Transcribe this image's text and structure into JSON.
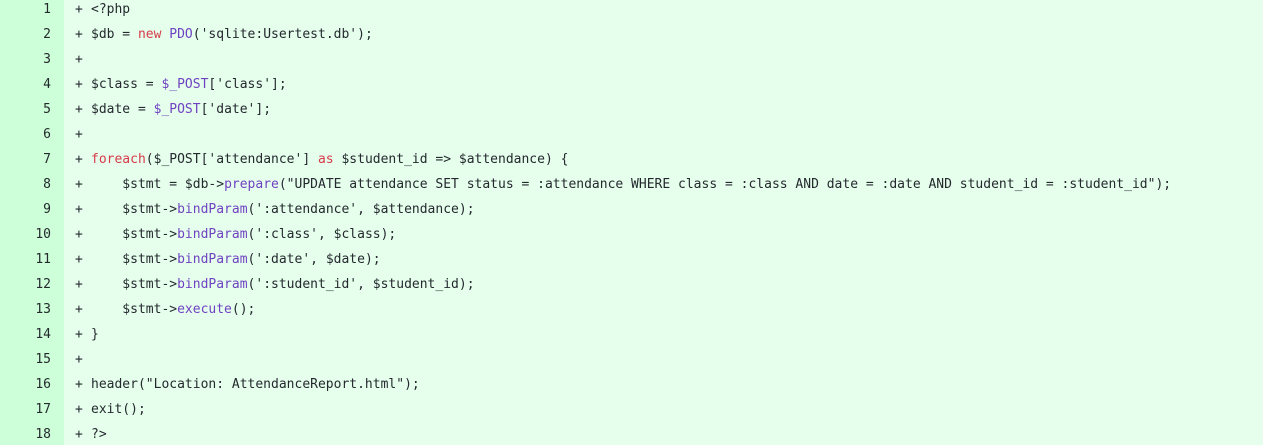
{
  "colors": {
    "background": "#e6ffed",
    "gutter": "#cdffd8",
    "keyword": "#d73a49",
    "function": "#6f42c1",
    "text": "#24292e"
  },
  "marker": "+",
  "lines": [
    {
      "n": "1",
      "tokens": [
        {
          "t": "<?php",
          "k": "plain"
        }
      ]
    },
    {
      "n": "2",
      "tokens": [
        {
          "t": "$db = ",
          "k": "plain"
        },
        {
          "t": "new",
          "k": "kw"
        },
        {
          "t": " ",
          "k": "plain"
        },
        {
          "t": "PDO",
          "k": "cls"
        },
        {
          "t": "('sqlite:Usertest.db');",
          "k": "plain"
        }
      ]
    },
    {
      "n": "3",
      "tokens": []
    },
    {
      "n": "4",
      "tokens": [
        {
          "t": "$class = ",
          "k": "plain"
        },
        {
          "t": "$_POST",
          "k": "cls"
        },
        {
          "t": "['class'];",
          "k": "plain"
        }
      ]
    },
    {
      "n": "5",
      "tokens": [
        {
          "t": "$date = ",
          "k": "plain"
        },
        {
          "t": "$_POST",
          "k": "cls"
        },
        {
          "t": "['date'];",
          "k": "plain"
        }
      ]
    },
    {
      "n": "6",
      "tokens": []
    },
    {
      "n": "7",
      "tokens": [
        {
          "t": "foreach",
          "k": "kw"
        },
        {
          "t": "($_POST['attendance'] ",
          "k": "plain"
        },
        {
          "t": "as",
          "k": "kw"
        },
        {
          "t": " $student_id => $attendance) {",
          "k": "plain"
        }
      ]
    },
    {
      "n": "8",
      "tokens": [
        {
          "t": "    $stmt = $db->",
          "k": "plain"
        },
        {
          "t": "prepare",
          "k": "fn"
        },
        {
          "t": "(\"UPDATE attendance SET status = :attendance WHERE class = :class AND date = :date AND student_id = :student_id\");",
          "k": "plain"
        }
      ]
    },
    {
      "n": "9",
      "tokens": [
        {
          "t": "    $stmt->",
          "k": "plain"
        },
        {
          "t": "bindParam",
          "k": "fn"
        },
        {
          "t": "(':attendance', $attendance);",
          "k": "plain"
        }
      ]
    },
    {
      "n": "10",
      "tokens": [
        {
          "t": "    $stmt->",
          "k": "plain"
        },
        {
          "t": "bindParam",
          "k": "fn"
        },
        {
          "t": "(':class', $class);",
          "k": "plain"
        }
      ]
    },
    {
      "n": "11",
      "tokens": [
        {
          "t": "    $stmt->",
          "k": "plain"
        },
        {
          "t": "bindParam",
          "k": "fn"
        },
        {
          "t": "(':date', $date);",
          "k": "plain"
        }
      ]
    },
    {
      "n": "12",
      "tokens": [
        {
          "t": "    $stmt->",
          "k": "plain"
        },
        {
          "t": "bindParam",
          "k": "fn"
        },
        {
          "t": "(':student_id', $student_id);",
          "k": "plain"
        }
      ]
    },
    {
      "n": "13",
      "tokens": [
        {
          "t": "    $stmt->",
          "k": "plain"
        },
        {
          "t": "execute",
          "k": "fn"
        },
        {
          "t": "();",
          "k": "plain"
        }
      ]
    },
    {
      "n": "14",
      "tokens": [
        {
          "t": "}",
          "k": "plain"
        }
      ]
    },
    {
      "n": "15",
      "tokens": []
    },
    {
      "n": "16",
      "tokens": [
        {
          "t": "header(\"Location: AttendanceReport.html\");",
          "k": "plain"
        }
      ]
    },
    {
      "n": "17",
      "tokens": [
        {
          "t": "exit();",
          "k": "plain"
        }
      ]
    },
    {
      "n": "18",
      "tokens": [
        {
          "t": "?>",
          "k": "plain"
        }
      ]
    }
  ]
}
